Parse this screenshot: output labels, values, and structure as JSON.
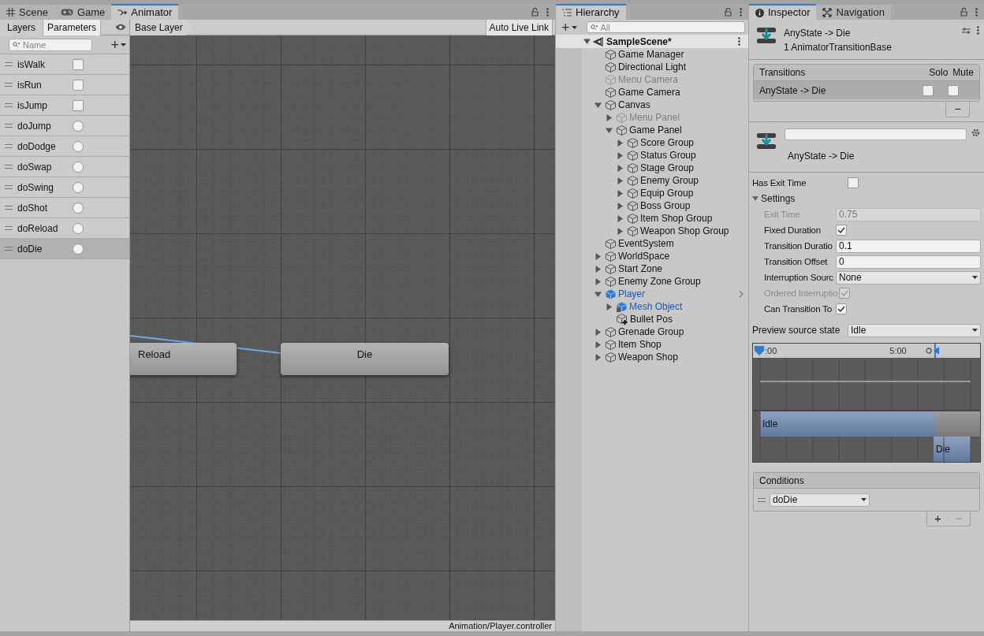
{
  "animator": {
    "tabs": [
      {
        "label": "Scene",
        "kind": "scene",
        "selected": false
      },
      {
        "label": "Game",
        "kind": "game",
        "selected": false
      },
      {
        "label": "Animator",
        "kind": "animator",
        "selected": true
      }
    ],
    "mode_tabs": [
      {
        "label": "Layers",
        "selected": false
      },
      {
        "label": "Parameters",
        "selected": true
      }
    ],
    "breadcrumb": "Base Layer",
    "live_link_button": "Auto Live Link",
    "search": {
      "placeholder": "Name"
    },
    "add_button": "+",
    "parameters": [
      {
        "name": "isWalk",
        "kind": "bool",
        "checked": false,
        "selected": false
      },
      {
        "name": "isRun",
        "kind": "bool",
        "checked": false,
        "selected": false
      },
      {
        "name": "isJump",
        "kind": "bool",
        "checked": false,
        "selected": false
      },
      {
        "name": "doJump",
        "kind": "trigger",
        "checked": false,
        "selected": false
      },
      {
        "name": "doDodge",
        "kind": "trigger",
        "checked": false,
        "selected": false
      },
      {
        "name": "doSwap",
        "kind": "trigger",
        "checked": false,
        "selected": false
      },
      {
        "name": "doSwing",
        "kind": "trigger",
        "checked": false,
        "selected": false
      },
      {
        "name": "doShot",
        "kind": "trigger",
        "checked": false,
        "selected": false
      },
      {
        "name": "doReload",
        "kind": "trigger",
        "checked": false,
        "selected": false
      },
      {
        "name": "doDie",
        "kind": "trigger",
        "checked": false,
        "selected": true
      }
    ],
    "states": [
      "Reload",
      "Die"
    ],
    "path": "Animation/Player.controller"
  },
  "hierarchy": {
    "tabs": [
      {
        "label": "Hierarchy",
        "kind": "list",
        "selected": true
      }
    ],
    "add_button": "+",
    "search": {
      "placeholder": "All"
    },
    "scene": {
      "name": "SampleScene*",
      "expanded": true
    },
    "items": [
      {
        "name": "Game Manager",
        "kind": "object",
        "inactive": false
      },
      {
        "name": "Directional Light",
        "kind": "object",
        "inactive": false
      },
      {
        "name": "Menu Camera",
        "kind": "object",
        "inactive": true
      },
      {
        "name": "Game Camera",
        "kind": "object",
        "inactive": false
      },
      {
        "name": "Canvas",
        "kind": "object",
        "inactive": false,
        "expanded": true,
        "children": [
          {
            "name": "Menu Panel",
            "kind": "object",
            "inactive": true,
            "expanded": false
          },
          {
            "name": "Game Panel",
            "kind": "object",
            "inactive": false,
            "expanded": true,
            "children": [
              {
                "name": "Score Group",
                "kind": "object",
                "inactive": false,
                "expanded": false
              },
              {
                "name": "Status Group",
                "kind": "object",
                "inactive": false,
                "expanded": false
              },
              {
                "name": "Stage Group",
                "kind": "object",
                "inactive": false,
                "expanded": false
              },
              {
                "name": "Enemy Group",
                "kind": "object",
                "inactive": false,
                "expanded": false
              },
              {
                "name": "Equip Group",
                "kind": "object",
                "inactive": false,
                "expanded": false
              },
              {
                "name": "Boss Group",
                "kind": "object",
                "inactive": false,
                "expanded": false
              },
              {
                "name": "Item Shop Group",
                "kind": "object",
                "inactive": false,
                "expanded": false
              },
              {
                "name": "Weapon Shop Group",
                "kind": "object",
                "inactive": false,
                "expanded": false
              }
            ]
          }
        ]
      },
      {
        "name": "EventSystem",
        "kind": "object",
        "inactive": false
      },
      {
        "name": "WorldSpace",
        "kind": "object",
        "inactive": false,
        "expanded": false
      },
      {
        "name": "Start Zone",
        "kind": "object",
        "inactive": false,
        "expanded": false
      },
      {
        "name": "Enemy Zone Group",
        "kind": "object",
        "inactive": false,
        "expanded": false
      },
      {
        "name": "Player",
        "kind": "prefab",
        "inactive": false,
        "expanded": true,
        "open_button": true,
        "children": [
          {
            "name": "Mesh Object",
            "kind": "model",
            "inactive": false,
            "expanded": false
          },
          {
            "name": "Bullet Pos",
            "kind": "added",
            "inactive": false
          }
        ]
      },
      {
        "name": "Grenade Group",
        "kind": "object",
        "inactive": false,
        "expanded": false
      },
      {
        "name": "Item Shop",
        "kind": "object",
        "inactive": false,
        "expanded": false
      },
      {
        "name": "Weapon Shop",
        "kind": "object",
        "inactive": false,
        "expanded": false
      }
    ]
  },
  "inspector": {
    "tabs": [
      {
        "label": "Inspector",
        "kind": "info",
        "selected": true
      },
      {
        "label": "Navigation",
        "kind": "navigation",
        "selected": false
      }
    ],
    "title": "AnyState -> Die",
    "subtitle": "1 AnimatorTransitionBase",
    "transitions": {
      "columns": [
        "Transitions",
        "Solo",
        "Mute"
      ],
      "rows": [
        {
          "name": "AnyState -> Die",
          "solo": false,
          "mute": false,
          "selected": true
        }
      ],
      "remove_button": "−"
    },
    "transition_label": "AnyState -> Die",
    "has_exit_time": {
      "label": "Has Exit Time",
      "checked": false
    },
    "settings": {
      "label": "Settings",
      "expanded": true,
      "fields": [
        {
          "label": "Exit Time",
          "kind": "number",
          "value": "0.75",
          "disabled": true
        },
        {
          "label": "Fixed Duration",
          "kind": "checkbox",
          "checked": true,
          "disabled": false
        },
        {
          "label": "Transition Duratio",
          "kind": "number",
          "value": "0.1",
          "disabled": false
        },
        {
          "label": "Transition Offset",
          "kind": "number",
          "value": "0",
          "disabled": false
        },
        {
          "label": "Interruption Sourc",
          "kind": "dropdown",
          "value": "None",
          "disabled": false
        },
        {
          "label": "Ordered Interruptio",
          "kind": "checkbox",
          "checked": true,
          "disabled": true
        },
        {
          "label": "Can Transition To",
          "kind": "checkbox",
          "checked": true,
          "disabled": false
        }
      ]
    },
    "preview": {
      "label": "Preview source state",
      "value": "Idle"
    },
    "timeline": {
      "ruler_labels": [
        ":00",
        "5:00"
      ],
      "source_clip": "Idle",
      "destination_clip": "Die"
    },
    "conditions": {
      "title": "Conditions",
      "items": [
        {
          "parameter": "doDie"
        }
      ],
      "buttons": [
        "+",
        "−"
      ]
    }
  }
}
